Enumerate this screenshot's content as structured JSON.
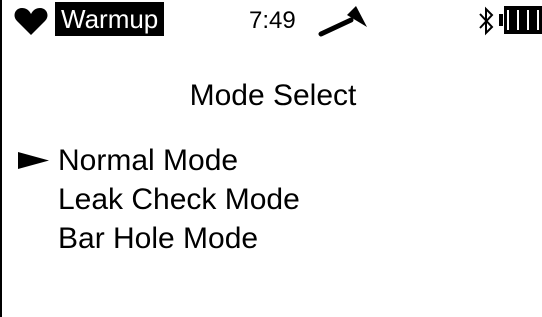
{
  "status_bar": {
    "mode_badge": "Warmup",
    "time": "7:49",
    "icons": {
      "heart": "heart-icon",
      "signal": "signal-icon",
      "bluetooth": "bluetooth-icon",
      "battery": "battery-icon"
    },
    "battery_level": 1.0
  },
  "screen": {
    "title": "Mode Select",
    "selected_index": 0,
    "items": [
      {
        "label": "Normal Mode",
        "selected": true
      },
      {
        "label": "Leak Check Mode",
        "selected": false
      },
      {
        "label": "Bar Hole Mode",
        "selected": false
      }
    ]
  },
  "colors": {
    "background": "#ffffff",
    "foreground": "#000000",
    "badge_text": "#ffffff"
  }
}
